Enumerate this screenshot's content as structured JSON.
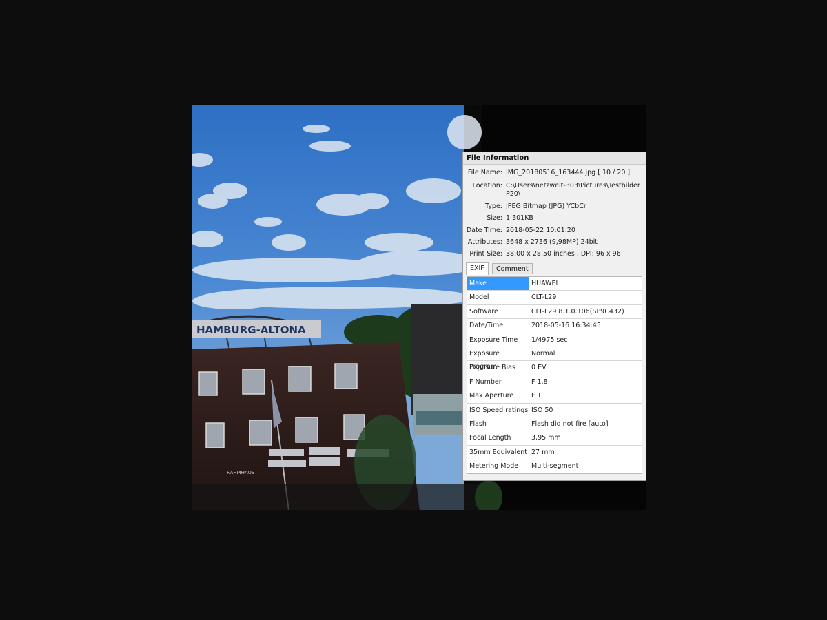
{
  "panel": {
    "title": "File Information",
    "file_name_label": "File Name:",
    "file_name_value": "IMG_20180516_163444.jpg   [ 10 / 20 ]",
    "location_label": "Location:",
    "location_value_line1": "C:\\Users\\netzwelt-303\\Pictures\\Testbilder",
    "location_value_line2": "P20\\",
    "type_label": "Type:",
    "type_value": "JPEG Bitmap (JPG) YCbCr",
    "size_label": "Size:",
    "size_value": "1.301KB",
    "datetime_label": "Date Time:",
    "datetime_value": "2018-05-22 10:01:20",
    "attributes_label": "Attributes:",
    "attributes_value": "3648 x 2736 (9,98MP)   24bit",
    "printsize_label": "Print Size:",
    "printsize_value": "38,00 x 28,50 inches ,   DPI: 96 x 96"
  },
  "tabs": [
    {
      "label": "EXIF"
    },
    {
      "label": "Comment"
    }
  ],
  "exif": [
    {
      "key": "Make",
      "value": "HUAWEI"
    },
    {
      "key": "Model",
      "value": "CLT-L29"
    },
    {
      "key": "Software",
      "value": "CLT-L29 8.1.0.106(SP9C432)"
    },
    {
      "key": "Date/Time",
      "value": "2018-05-16 16:34:45"
    },
    {
      "key": "Exposure Time",
      "value": "1/4975 sec"
    },
    {
      "key": "Exposure Program",
      "value": "Normal"
    },
    {
      "key": "Exposure Bias",
      "value": "0 EV"
    },
    {
      "key": "F Number",
      "value": "F 1,8"
    },
    {
      "key": "Max Aperture",
      "value": "F 1"
    },
    {
      "key": "ISO Speed ratings",
      "value": "ISO 50"
    },
    {
      "key": "Flash",
      "value": "Flash did not fire [auto]"
    },
    {
      "key": "Focal Length",
      "value": "3,95 mm"
    },
    {
      "key": "35mm Equivalent",
      "value": "27 mm"
    },
    {
      "key": "Metering Mode",
      "value": "Multi-segment"
    }
  ],
  "photo": {
    "sign_text": "HAMBURG-ALTONA",
    "shop_text": "RAHMHAUS"
  },
  "colors": {
    "selection": "#3399ff",
    "sky": "#3a78c8"
  }
}
